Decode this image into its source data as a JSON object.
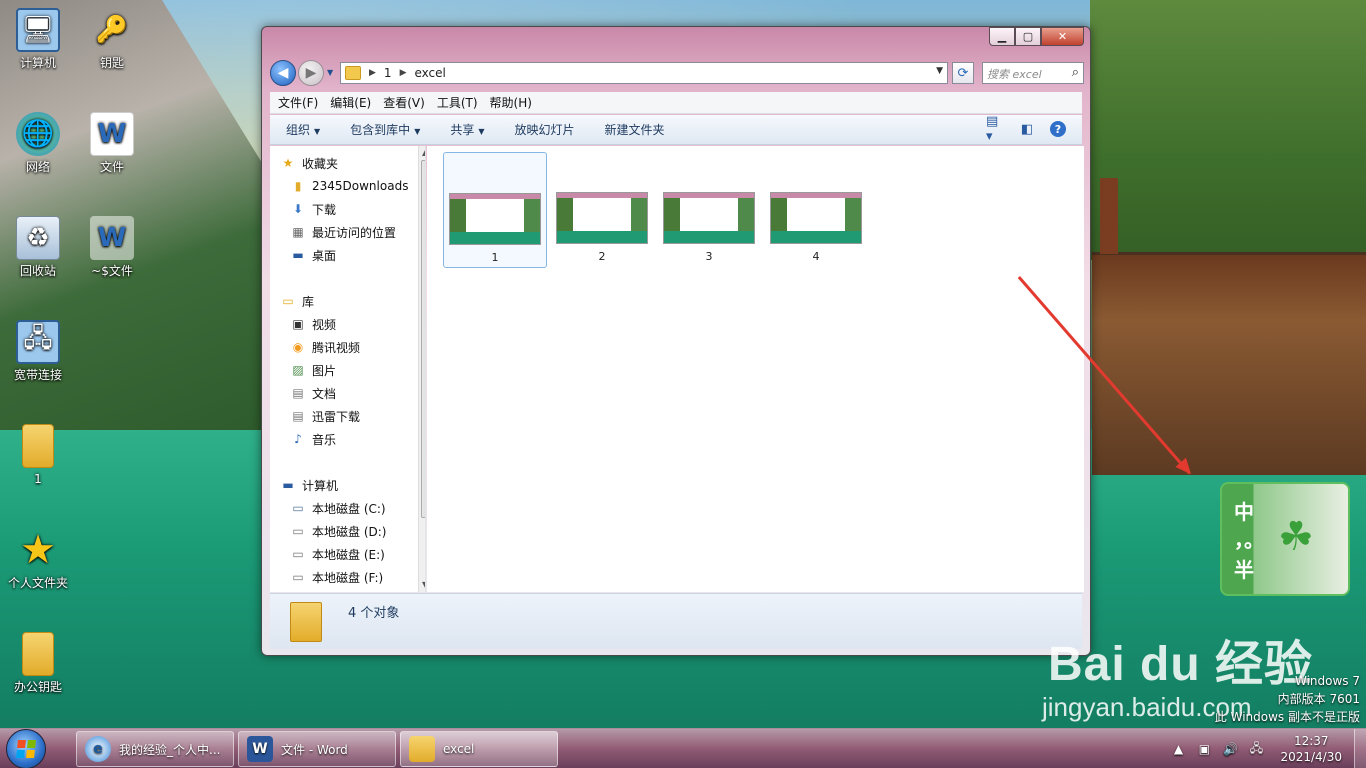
{
  "desktop": {
    "icons": [
      {
        "label": "计算机",
        "icon": "computer-icon"
      },
      {
        "label": "钥匙",
        "icon": "keys-icon"
      },
      {
        "label": "网络",
        "icon": "network-icon"
      },
      {
        "label": "文件",
        "icon": "wps-doc-icon"
      },
      {
        "label": "回收站",
        "icon": "recycle-bin-icon"
      },
      {
        "label": "~$文件",
        "icon": "temp-doc-icon"
      },
      {
        "label": "宽带连接",
        "icon": "broadband-icon"
      },
      {
        "label": "1",
        "icon": "folder-icon"
      },
      {
        "label": "个人文件夹",
        "icon": "star-icon"
      },
      {
        "label": "办公钥匙",
        "icon": "folder-icon"
      }
    ]
  },
  "window": {
    "address": {
      "root": "1",
      "current": "excel"
    },
    "search_placeholder": "搜索 excel",
    "menu": [
      "文件(F)",
      "编辑(E)",
      "查看(V)",
      "工具(T)",
      "帮助(H)"
    ],
    "toolbar": [
      "组织",
      "包含到库中",
      "共享",
      "放映幻灯片",
      "新建文件夹"
    ],
    "nav": {
      "favorites": "收藏夹",
      "favorites_items": [
        "2345Downloads",
        "下载",
        "最近访问的位置",
        "桌面"
      ],
      "libraries": "库",
      "libraries_items": [
        "视频",
        "腾讯视频",
        "图片",
        "文档",
        "迅雷下载",
        "音乐"
      ],
      "computer": "计算机",
      "computer_items": [
        "本地磁盘 (C:)",
        "本地磁盘 (D:)",
        "本地磁盘 (E:)",
        "本地磁盘 (F:)"
      ]
    },
    "files": [
      "1",
      "2",
      "3",
      "4"
    ],
    "status": "4 个对象"
  },
  "ime": {
    "chars": [
      "中",
      "，。",
      "半"
    ]
  },
  "watermark": {
    "brand": "Bai du 经验",
    "url": "jingyan.baidu.com"
  },
  "windows_version": [
    "Windows 7",
    "内部版本 7601",
    "此 Windows 副本不是正版"
  ],
  "taskbar": {
    "items": [
      {
        "label": "我的经验_个人中...",
        "icon": "browser-icon"
      },
      {
        "label": "文件 - Word",
        "icon": "word-icon"
      },
      {
        "label": "excel",
        "icon": "folder-icon"
      }
    ],
    "time": "12:37",
    "date": "2021/4/30"
  },
  "colors": {
    "accent": "#2b6ec9",
    "window_frame": "#c988a8",
    "ime_green": "#4ea64e",
    "arrow_red": "#e23a2f"
  }
}
